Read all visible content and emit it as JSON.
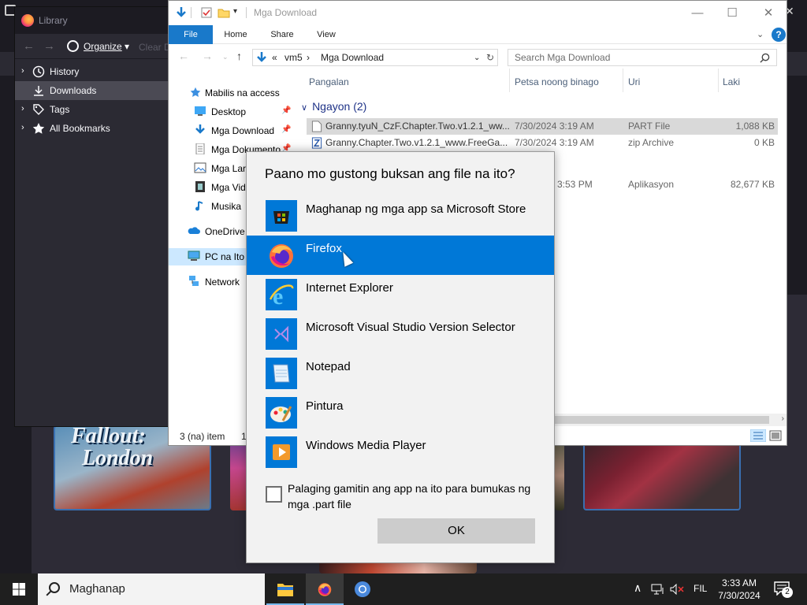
{
  "browser": {
    "tile_text_line1": "Fallout:",
    "tile_text_line2": "London"
  },
  "library": {
    "title": "Library",
    "organize_label": "Organize",
    "clear_label": "Clear D",
    "items": [
      {
        "label": "History",
        "icon": "clock-icon"
      },
      {
        "label": "Downloads",
        "icon": "download-icon"
      },
      {
        "label": "Tags",
        "icon": "tag-icon"
      },
      {
        "label": "All Bookmarks",
        "icon": "star-icon"
      }
    ]
  },
  "explorer": {
    "title": "Mga Download",
    "ribbon_tabs": [
      "File",
      "Home",
      "Share",
      "View"
    ],
    "breadcrumb": [
      "«",
      "vm5",
      "›",
      "Mga Download"
    ],
    "search_placeholder": "Search Mga Download",
    "columns": [
      "Pangalan",
      "Petsa noong binago",
      "Uri",
      "Laki"
    ],
    "group_label": "Ngayon (2)",
    "nav": [
      {
        "label": "Mabilis na access",
        "icon": "star-icon"
      },
      {
        "label": "Desktop",
        "icon": "desktop-icon",
        "pinned": true
      },
      {
        "label": "Mga Download",
        "icon": "download-icon",
        "pinned": true
      },
      {
        "label": "Mga Dokumento",
        "icon": "document-icon",
        "pinned": true
      },
      {
        "label": "Mga Lara",
        "icon": "picture-icon"
      },
      {
        "label": "Mga Vid",
        "icon": "video-icon"
      },
      {
        "label": "Musika",
        "icon": "music-icon"
      },
      {
        "label": "OneDrive",
        "icon": "cloud-icon"
      },
      {
        "label": "PC na Ito",
        "icon": "computer-icon"
      },
      {
        "label": "Network",
        "icon": "network-icon"
      }
    ],
    "files": [
      {
        "name": "Granny.tyuN_CzF.Chapter.Two.v1.2.1_ww...",
        "date": "7/30/2024 3:19 AM",
        "type": "PART File",
        "size": "1,088 KB"
      },
      {
        "name": "Granny.Chapter.Two.v1.2.1_www.FreeGa...",
        "date": "7/30/2024 3:19 AM",
        "type": "zip Archive",
        "size": "0 KB"
      },
      {
        "name": "",
        "date": "3:53 PM",
        "type": "Aplikasyon",
        "size": "82,677 KB"
      }
    ],
    "status": "3 (na) item",
    "status_extra": "1"
  },
  "dialog": {
    "title": "Paano mo gustong buksan ang file na ito?",
    "apps": [
      {
        "name": "Maghanap ng mga app sa Microsoft Store",
        "icon": "store-icon"
      },
      {
        "name": "Firefox",
        "icon": "firefox-icon"
      },
      {
        "name": "Internet Explorer",
        "icon": "ie-icon"
      },
      {
        "name": "Microsoft Visual Studio Version Selector",
        "icon": "visual-studio-icon"
      },
      {
        "name": "Notepad",
        "icon": "notepad-icon"
      },
      {
        "name": "Pintura",
        "icon": "paint-icon"
      },
      {
        "name": "Windows Media Player",
        "icon": "media-player-icon"
      }
    ],
    "selected_app": "Firefox",
    "checkbox_label": "Palaging gamitin ang app na ito para bumukas ng mga .part file",
    "checkbox_checked": false,
    "ok_label": "OK"
  },
  "taskbar": {
    "search_placeholder": "Maghanap",
    "language": "FIL",
    "time": "3:33 AM",
    "date": "7/30/2024",
    "notification_count": "2"
  },
  "colors": {
    "accent": "#0078d7",
    "ribbon_file": "#1979ca",
    "taskbar": "#1f1f1f",
    "dark_ui": "#2b2a33"
  }
}
